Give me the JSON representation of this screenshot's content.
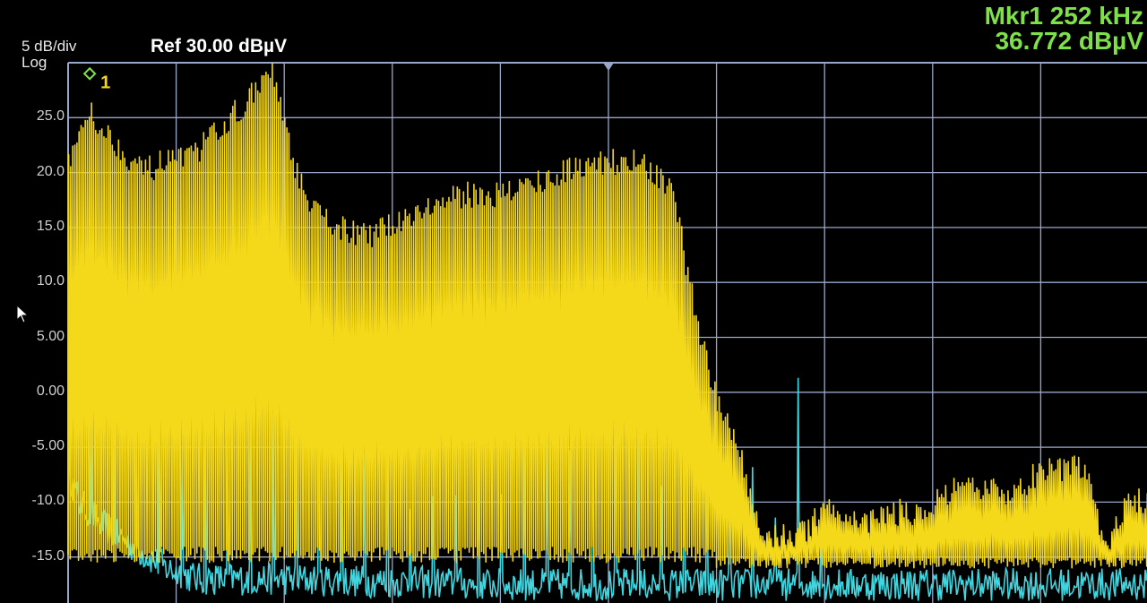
{
  "header": {
    "scale_per_div": "5 dB/div",
    "scale_type": "Log",
    "ref_level": "Ref 30.00 dBµV"
  },
  "marker": {
    "label": "1",
    "frequency": "Mkr1 252 kHz",
    "amplitude": "36.772 dBµV"
  },
  "colors": {
    "background": "#000000",
    "grid": "#9aa6c8",
    "trace1": "#f4d81a",
    "trace2": "#3fd6e0",
    "marker_text": "#7fe14a"
  },
  "chart_data": {
    "type": "line",
    "yunit": "dBµV",
    "ylim": [
      -17.5,
      30
    ],
    "yticks": [
      "25.0",
      "20.0",
      "15.0",
      "10.0",
      "5.00",
      "0.00",
      "-5.00",
      "-10.0",
      "-15.0"
    ],
    "grid": true,
    "series": [
      {
        "color": "#f4d81a",
        "envelope": [
          [
            0,
            21
          ],
          [
            2,
            26
          ],
          [
            3,
            24
          ],
          [
            5,
            22
          ],
          [
            7,
            20
          ],
          [
            9,
            21
          ],
          [
            11,
            21
          ],
          [
            13,
            23
          ],
          [
            15,
            25
          ],
          [
            17,
            27
          ],
          [
            19,
            29
          ],
          [
            20,
            24
          ],
          [
            22,
            17
          ],
          [
            25,
            15
          ],
          [
            28,
            14
          ],
          [
            31,
            16
          ],
          [
            34,
            17
          ],
          [
            37,
            18
          ],
          [
            40,
            18
          ],
          [
            43,
            19
          ],
          [
            46,
            20
          ],
          [
            48,
            21
          ],
          [
            50,
            21
          ],
          [
            52,
            21
          ],
          [
            54,
            20
          ],
          [
            56,
            18
          ],
          [
            58,
            7
          ],
          [
            60,
            -1
          ],
          [
            62,
            -5
          ],
          [
            64,
            -13
          ],
          [
            66,
            -13
          ],
          [
            68,
            -13
          ],
          [
            70,
            -10
          ],
          [
            73,
            -12
          ],
          [
            76,
            -11
          ],
          [
            79,
            -11
          ],
          [
            82,
            -9
          ],
          [
            85,
            -9
          ],
          [
            88,
            -9
          ],
          [
            90,
            -7
          ],
          [
            92,
            -7
          ],
          [
            94,
            -7
          ],
          [
            96,
            -14
          ],
          [
            98,
            -10
          ],
          [
            100,
            -10
          ]
        ]
      },
      {
        "color": "#3fd6e0",
        "envelope": [
          [
            0,
            -7
          ],
          [
            1,
            -10
          ],
          [
            3,
            -12
          ],
          [
            6,
            -14
          ],
          [
            9,
            -16
          ],
          [
            12,
            -17
          ],
          [
            20,
            -17
          ],
          [
            40,
            -17.5
          ],
          [
            60,
            -17.5
          ],
          [
            80,
            -17.5
          ],
          [
            100,
            -17.5
          ]
        ]
      }
    ]
  }
}
